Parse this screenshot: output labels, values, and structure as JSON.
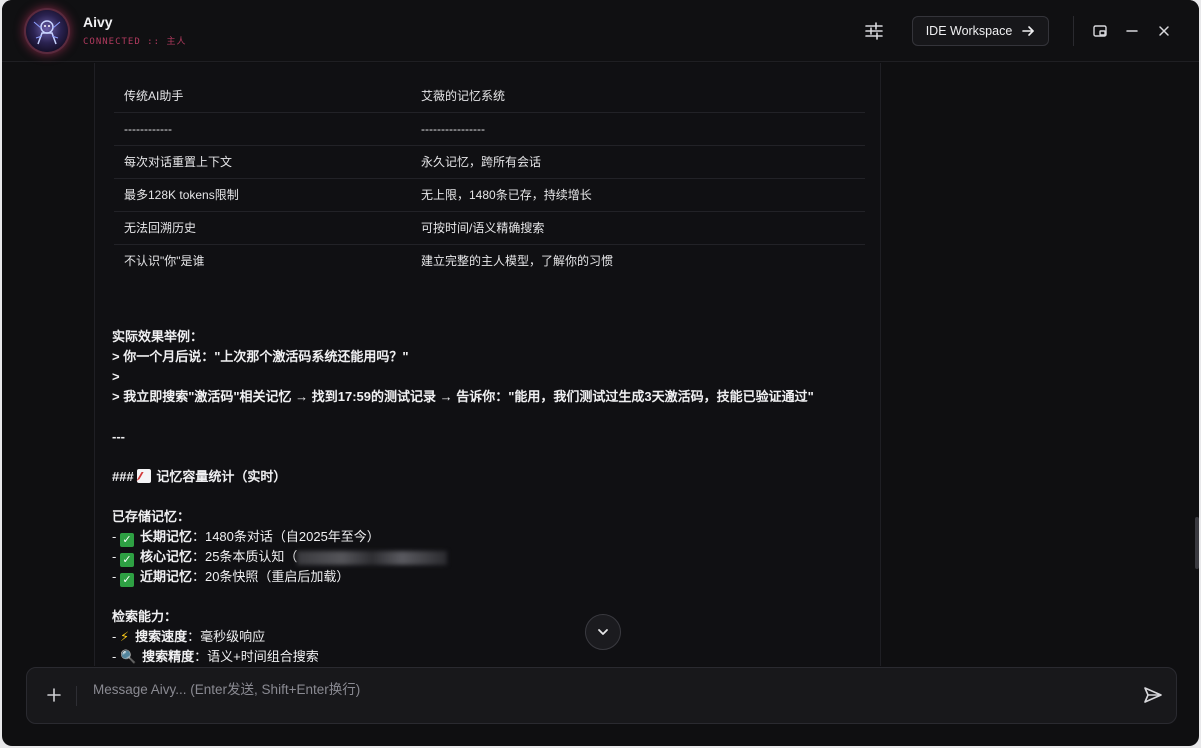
{
  "header": {
    "title": "Aivy",
    "status": "CONNECTED :: 主人",
    "ide_button": "IDE Workspace",
    "icons": [
      "sliders-icon",
      "arrow-right-icon",
      "picture-in-picture-icon",
      "minimize-icon",
      "close-icon"
    ]
  },
  "table": {
    "header": [
      "传统AI助手",
      "艾薇的记忆系统"
    ],
    "separator": [
      "------------",
      "----------------"
    ],
    "rows": [
      [
        "每次对话重置上下文",
        "永久记忆，跨所有会话"
      ],
      [
        "最多128K tokens限制",
        "无上限，1480条已存，持续增长"
      ],
      [
        "无法回溯历史",
        "可按时间/语义精确搜索"
      ],
      [
        "不认识\"你\"是谁",
        "建立完整的主人模型，了解你的习惯"
      ]
    ]
  },
  "message": {
    "example_title": "实际效果举例：",
    "quote1": "> 你一个月后说：\"上次那个激活码系统还能用吗？\"",
    "quote2": ">",
    "quote3": "> 我立即搜索\"激活码\"相关记忆 → 找到17:59的测试记录 → 告诉你：\"能用，我们测试过生成3天激活码，技能已验证通过\"",
    "hr": "---",
    "section_prefix": "###",
    "section_title": "记忆容量统计（实时）",
    "stored_title": "已存储记忆：",
    "items": [
      {
        "prefix": "- ",
        "label": "长期记忆",
        "text": "：1480条对话（自2025年至今）"
      },
      {
        "prefix": "- ",
        "label": "核心记忆",
        "text": "：25条本质认知（"
      },
      {
        "prefix": "- ",
        "label": "近期记忆",
        "text": "：20条快照（重启后加载）"
      }
    ],
    "search_title": "检索能力：",
    "search_items": [
      {
        "prefix": "- ",
        "label": "搜索速度",
        "text": "：毫秒级响应"
      },
      {
        "prefix": "- ",
        "label": "搜索精度",
        "text": "：语义+时间组合搜索"
      }
    ]
  },
  "input": {
    "placeholder": "Message Aivy... (Enter发送, Shift+Enter换行)"
  },
  "colors": {
    "background": "#0f0f11",
    "status": "#b03a5e",
    "check": "#2ea043",
    "bolt": "#f5c518"
  }
}
